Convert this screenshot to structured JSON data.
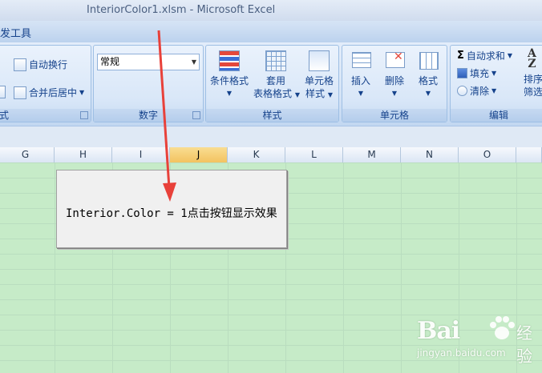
{
  "window": {
    "title": "InteriorColor1.xlsm - Microsoft Excel"
  },
  "ribbon": {
    "tab_partial": "发工具",
    "alignment": {
      "wrap_text": "自动换行",
      "merge_center": "合并后居中",
      "label_partial": "式"
    },
    "number": {
      "format_value": "常规",
      "percent_symbol": "%",
      "comma_symbol": ",",
      "label": "数字"
    },
    "styles": {
      "conditional_format": "条件格式",
      "table_format_line1": "套用",
      "table_format_line2": "表格格式",
      "cell_style_line1": "单元格",
      "cell_style_line2": "样式",
      "label": "样式"
    },
    "cells": {
      "insert": "插入",
      "delete": "删除",
      "format": "格式",
      "label": "单元格"
    },
    "editing": {
      "autosum": "自动求和",
      "fill": "填充",
      "clear": "清除",
      "sort_line1": "排序",
      "sort_line2": "筛选",
      "label": "编辑"
    }
  },
  "columns": [
    "G",
    "H",
    "I",
    "J",
    "K",
    "L",
    "M",
    "N",
    "O"
  ],
  "selected_column": "J",
  "sheet_button": {
    "label": "Interior.Color = 1点击按钮显示效果"
  },
  "watermark": {
    "brand": "Bai",
    "brand2": "经验",
    "url": "jingyan.baidu.com"
  },
  "colors": {
    "grid_background": "#c6ebc8",
    "arrow": "#e8413a"
  }
}
